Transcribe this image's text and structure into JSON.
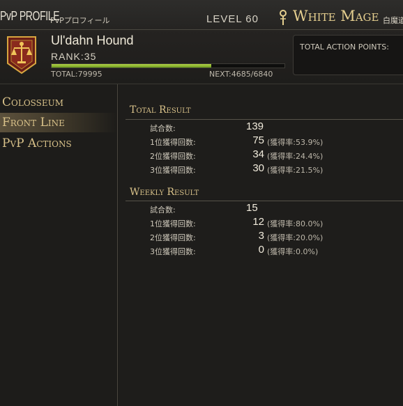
{
  "titlebar": {
    "title": "PvP PROFILE",
    "subtitle": "PvPプロフィール",
    "level": "LEVEL 60",
    "job": "White Mage",
    "job_jp": "白魔道"
  },
  "profile": {
    "name": "Ul'dahn Hound",
    "rank": "RANK:35",
    "exp_progress": 0.6849,
    "total": "TOTAL:79995",
    "next": "NEXT:4685/6840",
    "action_points_label": "TOTAL ACTION POINTS:"
  },
  "sidebar": {
    "items": [
      {
        "label": "Colosseum"
      },
      {
        "label": "Front Line"
      },
      {
        "label": "PvP Actions"
      }
    ]
  },
  "total_result": {
    "title": "Total Result",
    "rows": [
      {
        "label": "試合数:",
        "value": "139",
        "rate": ""
      },
      {
        "label": "1位獲得回数:",
        "value": "75",
        "rate": "(獲得率:53.9%)"
      },
      {
        "label": "2位獲得回数:",
        "value": "34",
        "rate": "(獲得率:24.4%)"
      },
      {
        "label": "3位獲得回数:",
        "value": "30",
        "rate": "(獲得率:21.5%)"
      }
    ]
  },
  "weekly_result": {
    "title": "Weekly Result",
    "rows": [
      {
        "label": "試合数:",
        "value": "15",
        "rate": ""
      },
      {
        "label": "1位獲得回数:",
        "value": "12",
        "rate": "(獲得率:80.0%)"
      },
      {
        "label": "2位獲得回数:",
        "value": "3",
        "rate": "(獲得率:20.0%)"
      },
      {
        "label": "3位獲得回数:",
        "value": "0",
        "rate": "(獲得率:0.0%)"
      }
    ]
  },
  "colors": {
    "accent_gold": "#d9c28a",
    "exp_bar": "#9cc23a",
    "active_item": "#5c513c"
  }
}
